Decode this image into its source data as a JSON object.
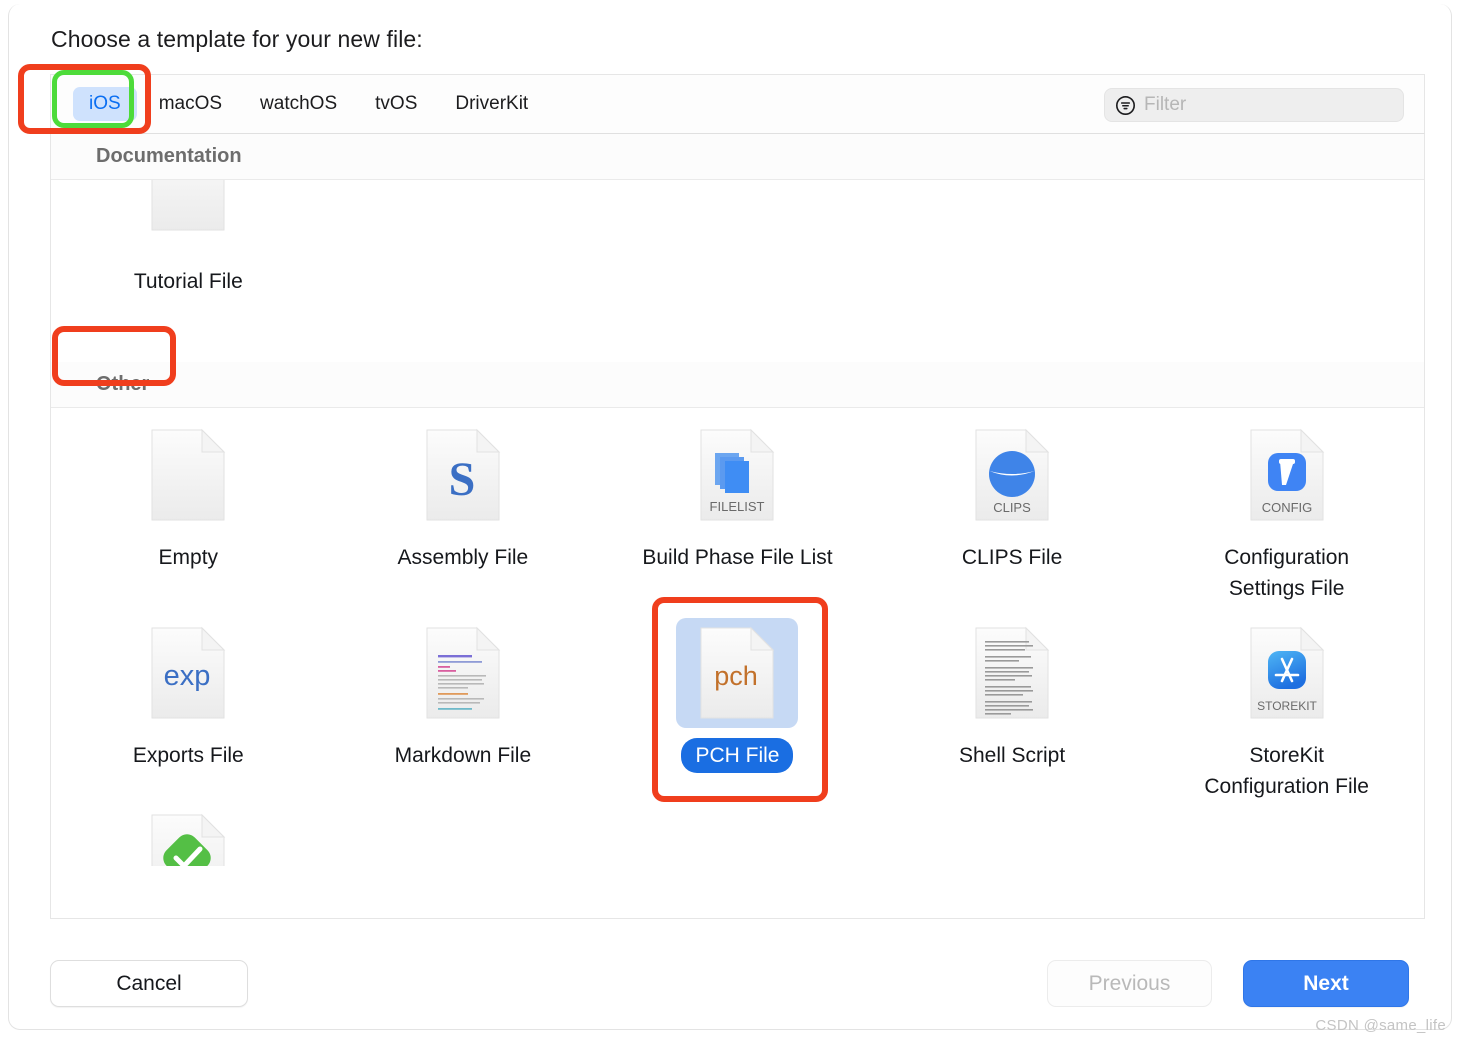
{
  "dialog": {
    "prompt": "Choose a template for your new file:"
  },
  "platform_tabs": [
    {
      "label": "iOS",
      "selected": true
    },
    {
      "label": "macOS",
      "selected": false
    },
    {
      "label": "watchOS",
      "selected": false
    },
    {
      "label": "tvOS",
      "selected": false
    },
    {
      "label": "DriverKit",
      "selected": false
    }
  ],
  "filter": {
    "placeholder": "Filter",
    "value": "",
    "icon": "filter-circle-icon"
  },
  "sections": [
    {
      "title": "Documentation",
      "items": [
        {
          "label": "Tutorial File",
          "icon": "blank-document-icon",
          "selected": false
        }
      ]
    },
    {
      "title": "Other",
      "items": [
        {
          "label": "Empty",
          "icon": "blank-document-icon",
          "selected": false
        },
        {
          "label": "Assembly File",
          "icon": "assembly-s-document-icon",
          "selected": false
        },
        {
          "label": "Build Phase File List",
          "icon": "filelist-document-icon",
          "badge": "FILELIST",
          "selected": false
        },
        {
          "label": "CLIPS File",
          "icon": "clips-document-icon",
          "badge": "CLIPS",
          "selected": false
        },
        {
          "label": "Configuration Settings File",
          "icon": "config-document-icon",
          "badge": "CONFIG",
          "selected": false
        },
        {
          "label": "Exports File",
          "icon": "exp-document-icon",
          "badge": "exp",
          "selected": false
        },
        {
          "label": "Markdown File",
          "icon": "markdown-document-icon",
          "selected": false
        },
        {
          "label": "PCH File",
          "icon": "pch-document-icon",
          "badge": "pch",
          "selected": true
        },
        {
          "label": "Shell Script",
          "icon": "shell-script-document-icon",
          "selected": false
        },
        {
          "label": "StoreKit Configuration File",
          "icon": "storekit-document-icon",
          "badge": "STOREKIT",
          "selected": false
        },
        {
          "label": "",
          "icon": "green-check-document-icon",
          "selected": false
        }
      ]
    }
  ],
  "footer": {
    "cancel_label": "Cancel",
    "previous_label": "Previous",
    "next_label": "Next"
  },
  "watermark": "CSDN @same_life",
  "colors": {
    "accent_blue": "#3b82f3",
    "tab_selected_bg": "#cfe2fd",
    "tab_selected_text": "#0b6ff2",
    "selection_bg": "#c6d9f4",
    "selection_label_bg": "#1a6ee2",
    "annotation_red": "#f03e1d",
    "annotation_green": "#4ddb3a",
    "group_header_text": "#6d6d6d"
  }
}
